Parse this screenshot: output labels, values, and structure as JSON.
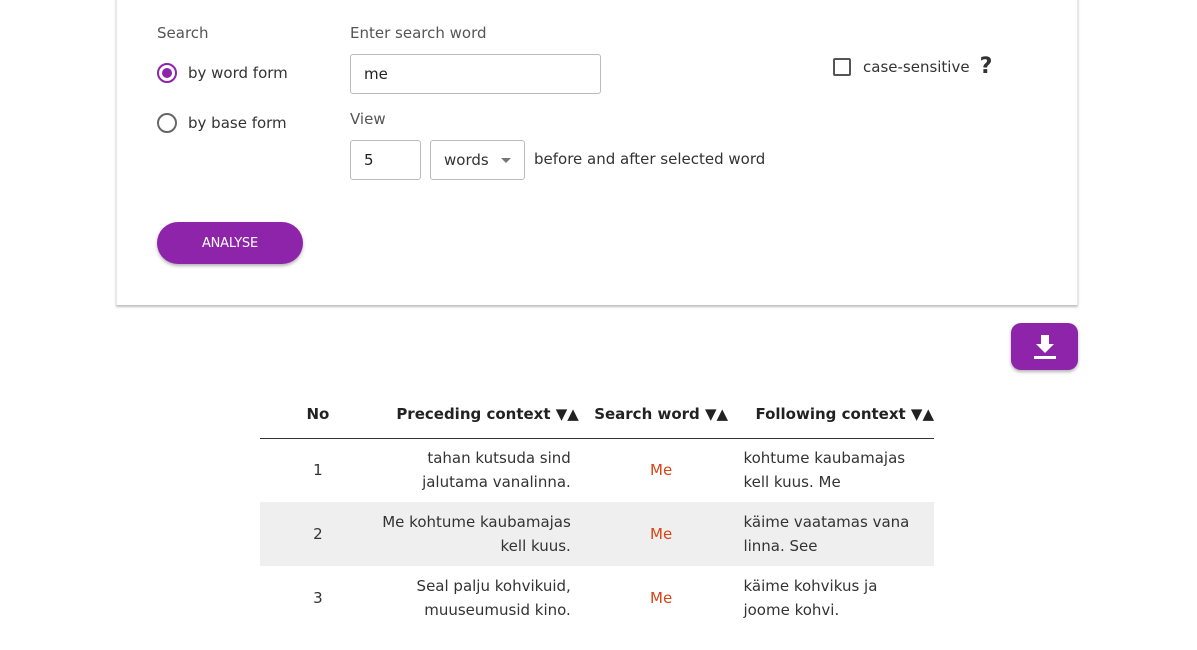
{
  "search_panel": {
    "search_label": "Search",
    "options": [
      {
        "label": "by word form",
        "checked": true
      },
      {
        "label": "by base form",
        "checked": false
      }
    ],
    "enter_label": "Enter search word",
    "search_value": "me",
    "view_label": "View",
    "view_count": "5",
    "view_unit": "words",
    "view_suffix": "before and after selected word",
    "case_sensitive_label": "case-sensitive",
    "help_glyph": "?",
    "analyse_label": "ANALYSE",
    "accent_color": "#8e24aa"
  },
  "download_icon": "download-icon",
  "table": {
    "headers": {
      "no": "No",
      "preceding": "Preceding context ▼▲",
      "search_word": "Search word ▼▲",
      "following": "Following context ▼▲"
    },
    "rows": [
      {
        "no": "1",
        "preceding": "tahan kutsuda sind jalutama vanalinna.",
        "word": "Me",
        "following": "kohtume kaubamajas kell kuus. Me"
      },
      {
        "no": "2",
        "preceding": "Me kohtume kaubamajas kell kuus.",
        "word": "Me",
        "following": "käime vaatamas vana linna. See"
      },
      {
        "no": "3",
        "preceding": "Seal palju kohvikuid, muuseumusid kino.",
        "word": "Me",
        "following": "käime kohvikus ja joome kohvi."
      }
    ],
    "highlight_color": "#d84315"
  }
}
